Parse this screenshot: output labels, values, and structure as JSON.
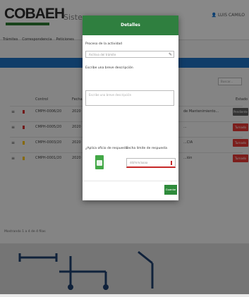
{
  "app": {
    "logo_text": "COBAEH",
    "system_title": "Sistema",
    "user_label": "LUIS CAMILO",
    "nav_items": [
      "Trámites",
      "Correspondencia",
      "Peticiones"
    ]
  },
  "list": {
    "search_placeholder": "Buscar...",
    "headers": {
      "control": "Control",
      "date": "Fecha",
      "state": "Estado"
    },
    "rows": [
      {
        "code": "CMPH-0006/20",
        "date": "2020",
        "desc": "de Mantenimiento...",
        "state": "Pendiente",
        "dot_color": "#d32f2f",
        "state_color": "#616161"
      },
      {
        "code": "CMPH-0005/20",
        "date": "2020",
        "desc": "...",
        "state": "Turnado",
        "dot_color": "#d32f2f",
        "state_color": "#e53935"
      },
      {
        "code": "CMPH-0003/20",
        "date": "2020",
        "desc": "...CIA",
        "state": "Turnado",
        "dot_color": "#f9c300",
        "state_color": "#e53935"
      },
      {
        "code": "CMPH-0001/20",
        "date": "2020",
        "desc": "...ión",
        "state": "Turnado",
        "dot_color": "#f9c300",
        "state_color": "#e53935"
      }
    ],
    "footer_note": "Mostrando 1 a 4 de 4 filas"
  },
  "modal": {
    "title": "Detalles",
    "field1_label": "Proceso de la actividad",
    "field1_value": "Archivo del trámite",
    "field2_label": "Escribe una breve descripción",
    "field2_placeholder": "Escribe una breve descripción",
    "toggle_label": "¿Aplica oficio de respuesta",
    "date_label": "Fecha límite de respuesta",
    "date_placeholder": "dd/mm/aaaa",
    "save_label": "Guardar",
    "accent_color": "#2f7f3f"
  }
}
